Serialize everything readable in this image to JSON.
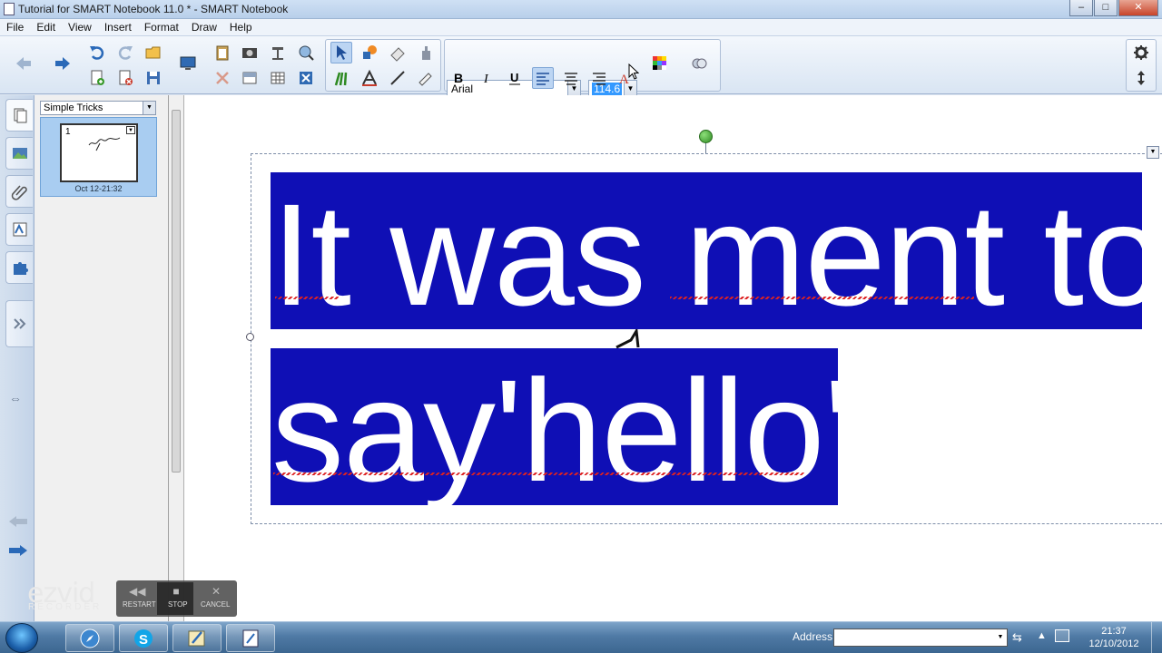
{
  "window": {
    "title": "Tutorial for SMART Notebook 11.0 * - SMART Notebook"
  },
  "menu": [
    "File",
    "Edit",
    "View",
    "Insert",
    "Format",
    "Draw",
    "Help"
  ],
  "toolbar": {
    "font_name": "Arial",
    "font_size": "114.6"
  },
  "sorter": {
    "group": "Simple Tricks",
    "page_number": "1",
    "page_date": "Oct 12-21:32"
  },
  "canvas": {
    "line1": "It was ment to",
    "line2": "say'hello'"
  },
  "overlay": {
    "brand": "ezvid",
    "sub": "RECORDER",
    "restart": "RESTART",
    "stop": "STOP",
    "cancel": "CANCEL"
  },
  "taskbar": {
    "address_label": "Address",
    "time": "21:37",
    "date": "12/10/2012"
  },
  "colors": {
    "highlight": "#0f0fb5",
    "canvas": "#ffffff",
    "taskbar": "#4f7aa5"
  }
}
